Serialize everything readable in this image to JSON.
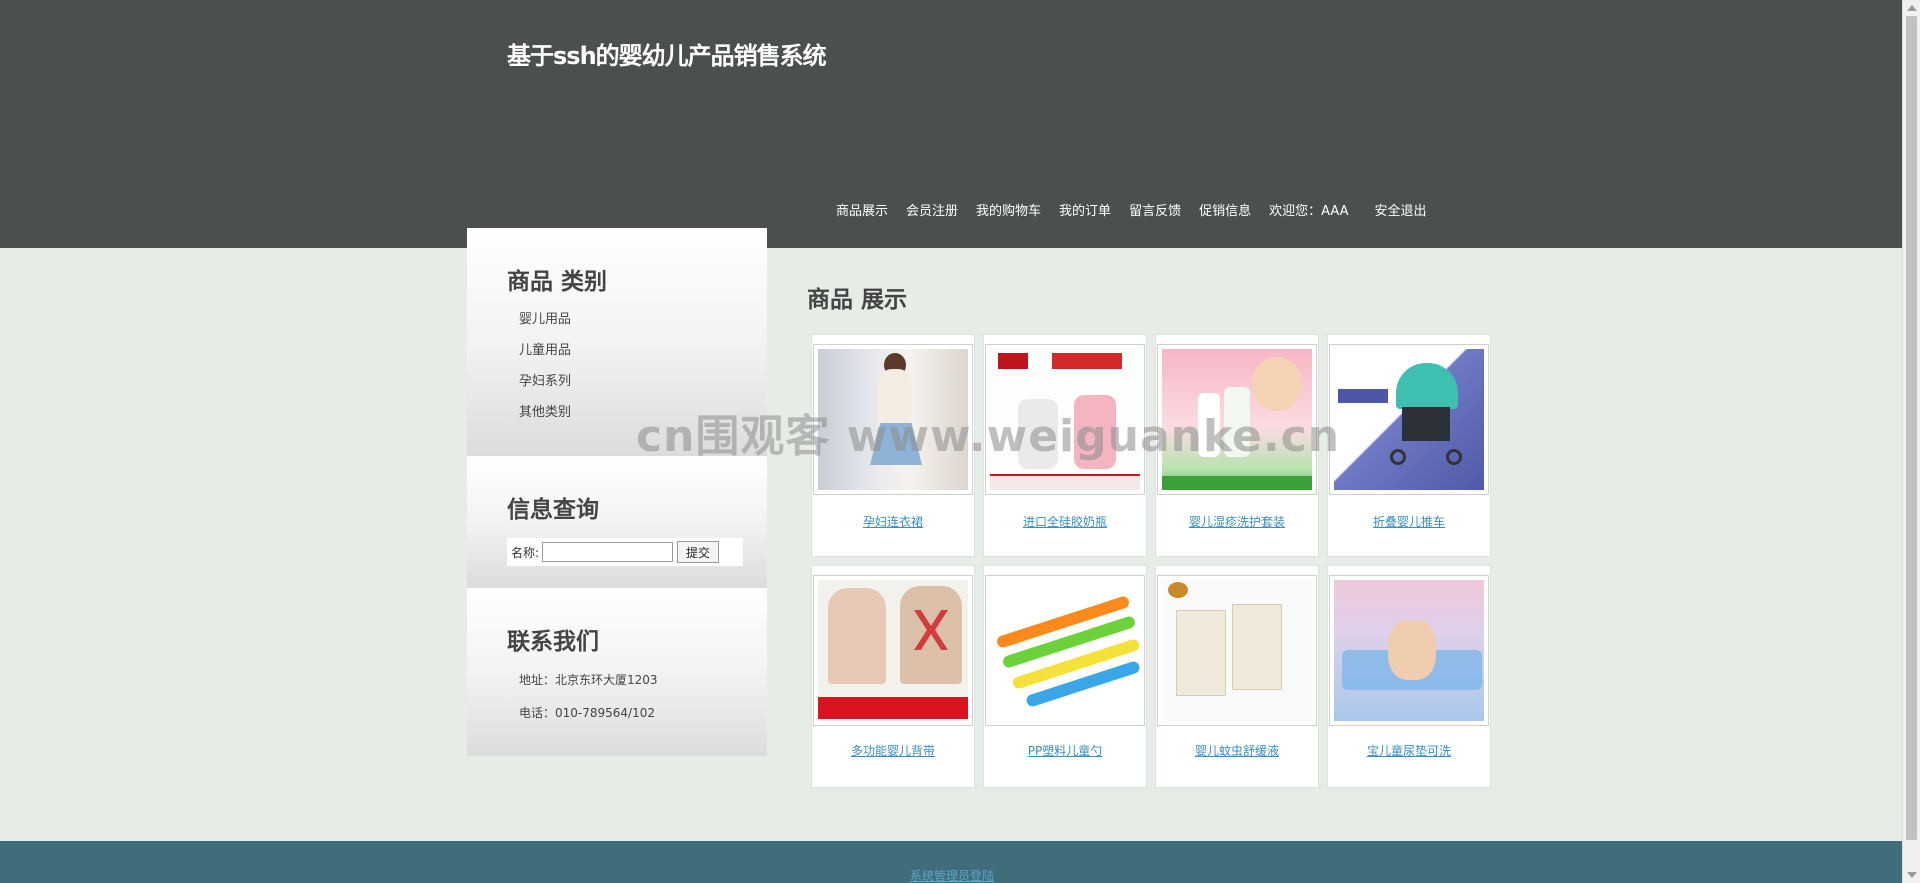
{
  "header": {
    "site_title": "基于ssh的婴幼儿产品销售系统",
    "nav": [
      {
        "label": "商品展示"
      },
      {
        "label": "会员注册"
      },
      {
        "label": "我的购物车"
      },
      {
        "label": "我的订单"
      },
      {
        "label": "留言反馈"
      },
      {
        "label": "促销信息"
      }
    ],
    "welcome": "欢迎您：AAA",
    "logout": "安全退出"
  },
  "sidebar": {
    "categories": {
      "title": "商品 类别",
      "items": [
        "婴儿用品",
        "儿童用品",
        "孕妇系列",
        "其他类别"
      ]
    },
    "search": {
      "title": "信息查询",
      "label": "名称:",
      "value": "",
      "placeholder": "",
      "submit": "提交"
    },
    "contact": {
      "title": "联系我们",
      "address": "地址：北京东环大厦1203",
      "phone": "电话：010-789564/102"
    }
  },
  "main": {
    "title": "商品 展示",
    "products": [
      {
        "name": "孕妇连衣裙",
        "icon": "dress-photo"
      },
      {
        "name": "进口全硅胶奶瓶",
        "icon": "bottle-photo"
      },
      {
        "name": "婴儿湿疹洗护套装",
        "icon": "lotion-photo"
      },
      {
        "name": "折叠婴儿推车",
        "icon": "stroller-photo"
      },
      {
        "name": "多功能婴儿背带",
        "icon": "carrier-photo"
      },
      {
        "name": "PP塑料儿童勺",
        "icon": "spoon-photo"
      },
      {
        "name": "婴儿蚊虫舒缓液",
        "icon": "nasal-photo"
      },
      {
        "name": "宝儿童尿垫可洗",
        "icon": "pad-photo"
      }
    ]
  },
  "watermark": "cn围观客 www.weiguanke.cn",
  "footer": {
    "admin_login": "系统管理员登陆"
  }
}
